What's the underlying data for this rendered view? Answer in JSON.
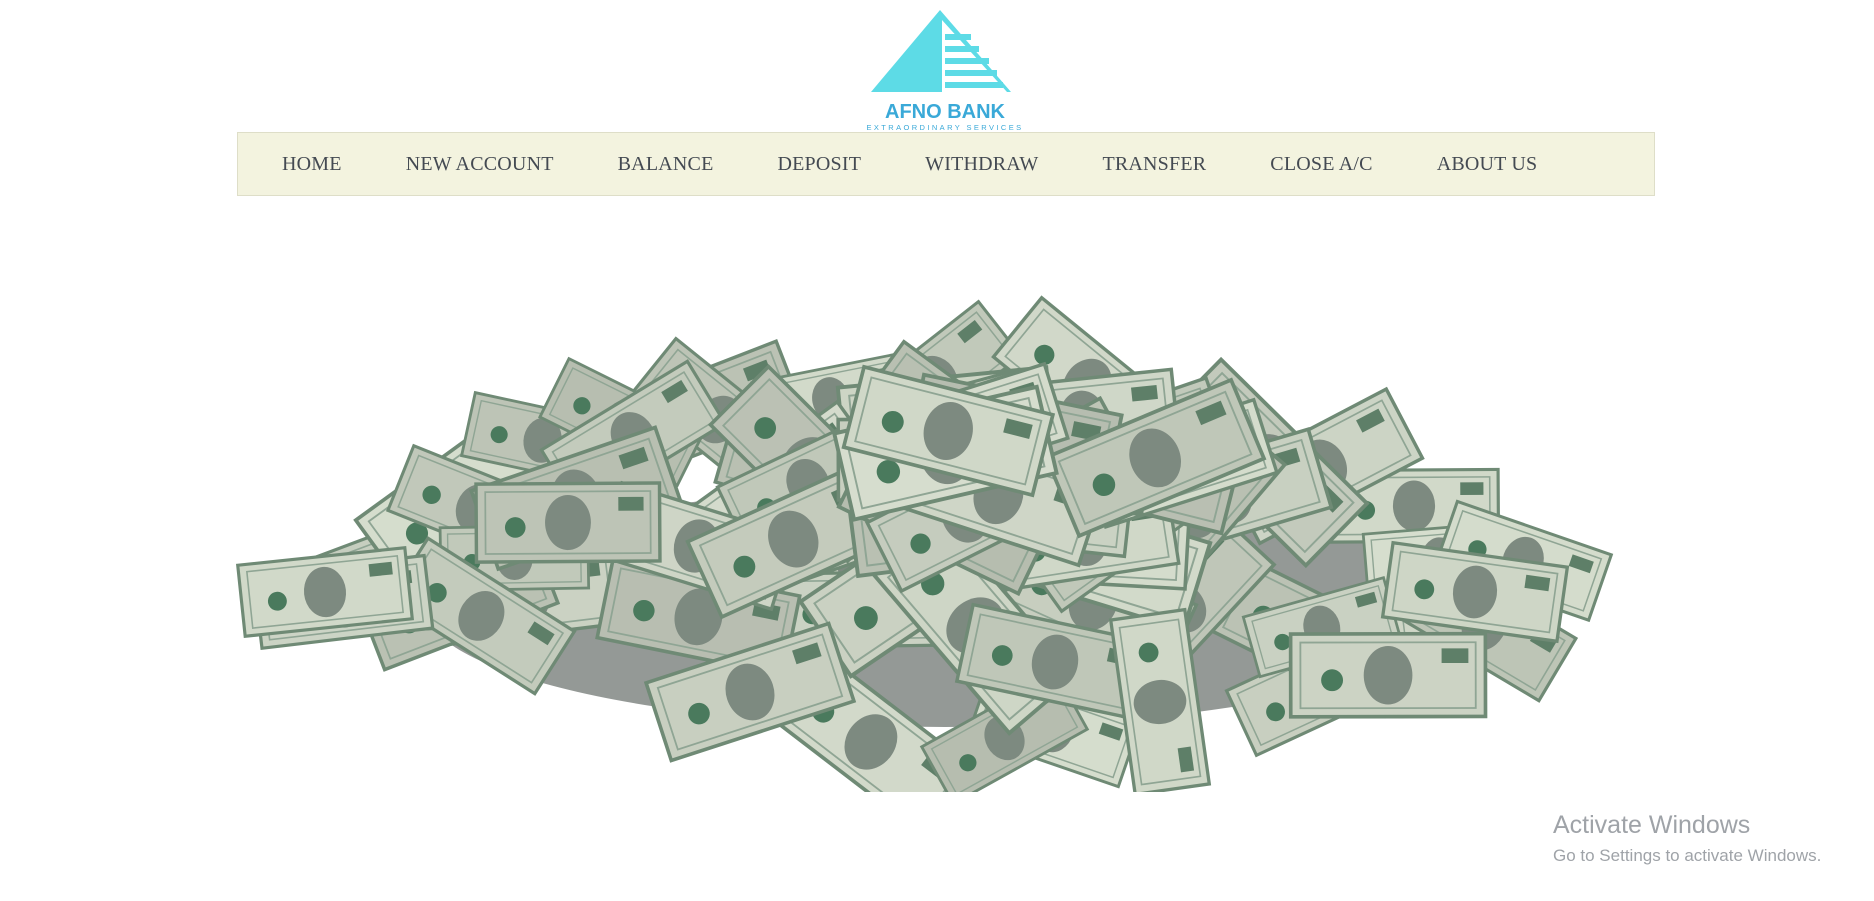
{
  "brand": {
    "name": "AFNO BANK",
    "tagline": "EXTRAORDINARY SERVICES",
    "accent_color": "#5ddbe6",
    "text_color": "#3aa9d8"
  },
  "nav": {
    "items": [
      "HOME",
      "NEW ACCOUNT",
      "BALANCE",
      "DEPOSIT",
      "WITHDRAW",
      "TRANSFER",
      "CLOSE A/C",
      "ABOUT US"
    ],
    "background": "#f3f3df"
  },
  "hero": {
    "image": "money-pile-illustration"
  },
  "watermark": {
    "title": "Activate Windows",
    "subtitle": "Go to Settings to activate Windows."
  }
}
